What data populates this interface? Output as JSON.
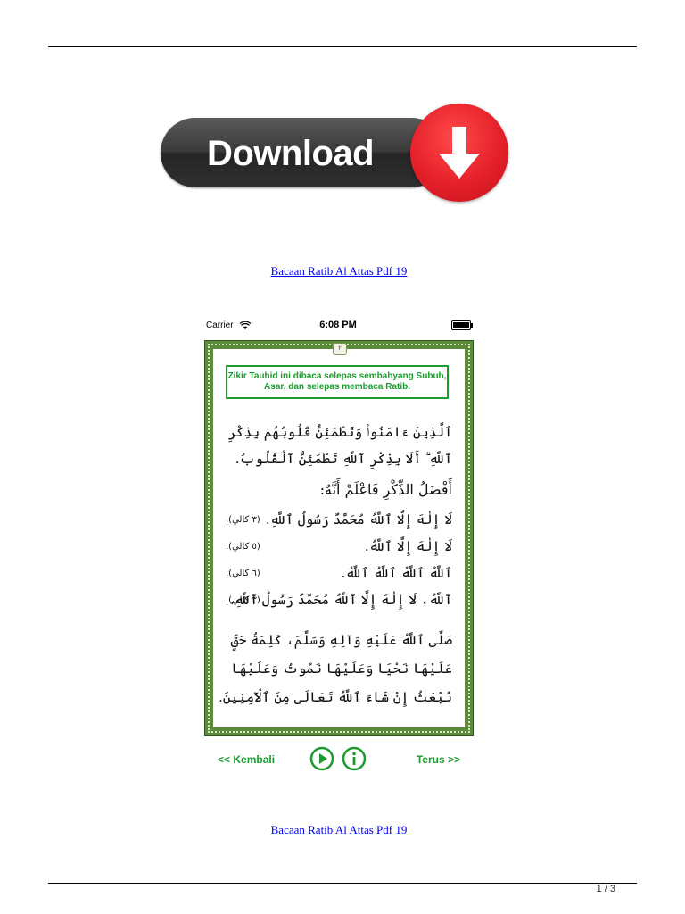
{
  "download_button": {
    "label": "Download"
  },
  "doc": {
    "link_top": "Bacaan Ratib Al Attas Pdf 19",
    "link_bottom": "Bacaan Ratib Al Attas Pdf 19",
    "page_number": "1 / 3"
  },
  "phone": {
    "status": {
      "carrier": "Carrier",
      "time": "6:08 PM",
      "battery_level": 1.0
    },
    "frame_badge": "٢",
    "note": "Zikir Tauhid  ini dibaca selepas sembahyang Subuh, Asar,  dan selepas membaca Ratib.",
    "verse": "ٱلَّذِينَ ءَامَنُوا۟ وَتَطْمَئِنُّ قُلُوبُهُم بِذِكْرِ ٱللَّهِ ۗ أَلَا بِذِكْرِ ٱللَّهِ تَطْمَئِنُّ ٱلْقُلُوبُ.",
    "heading": "أَفْضَلُ الذِّكْرِ فَاعْلَمْ أَنَّهُ:",
    "lines": [
      {
        "text": "لَا إِلٰهَ إِلَّا ٱللَّهُ مُحَمَّدٌ رَسُولُ ٱللَّهِ.",
        "count": "(٣ كالي)."
      },
      {
        "text": "لَا إِلٰهَ إِلَّا ٱللَّهُ.",
        "count": "(٥ كالي)."
      },
      {
        "text": "ٱللَّهُ ٱللَّهُ ٱللَّهُ ٱللَّهُ.",
        "count": "(٦ كالي)."
      },
      {
        "text": "ٱللَّهُ، لَا إِلٰهَ إِلَّا ٱللَّهُ مُحَمَّدٌ رَسُولُ ٱللَّهِ.",
        "count": "(٣ كالي)."
      }
    ],
    "closing": "صَلَّى ٱللَّهُ عَلَيْهِ وَآلِهِ وَسَلَّمَ، كَلِمَةُ حَقٍّ عَلَيْهَا نَحْيَا وَعَلَيْهَا نَمُوتُ وَعَلَيْهَا نُبْعَثُ إِنْ شَاءَ ٱللَّهُ تَعَالَى مِنَ ٱلْآمِنِينَ.",
    "nav": {
      "back": "<< Kembali",
      "next": "Terus >>"
    }
  },
  "colors": {
    "accent_green": "#1c9a2e",
    "frame_green": "#5b8a3a",
    "download_red": "#e5202a"
  }
}
